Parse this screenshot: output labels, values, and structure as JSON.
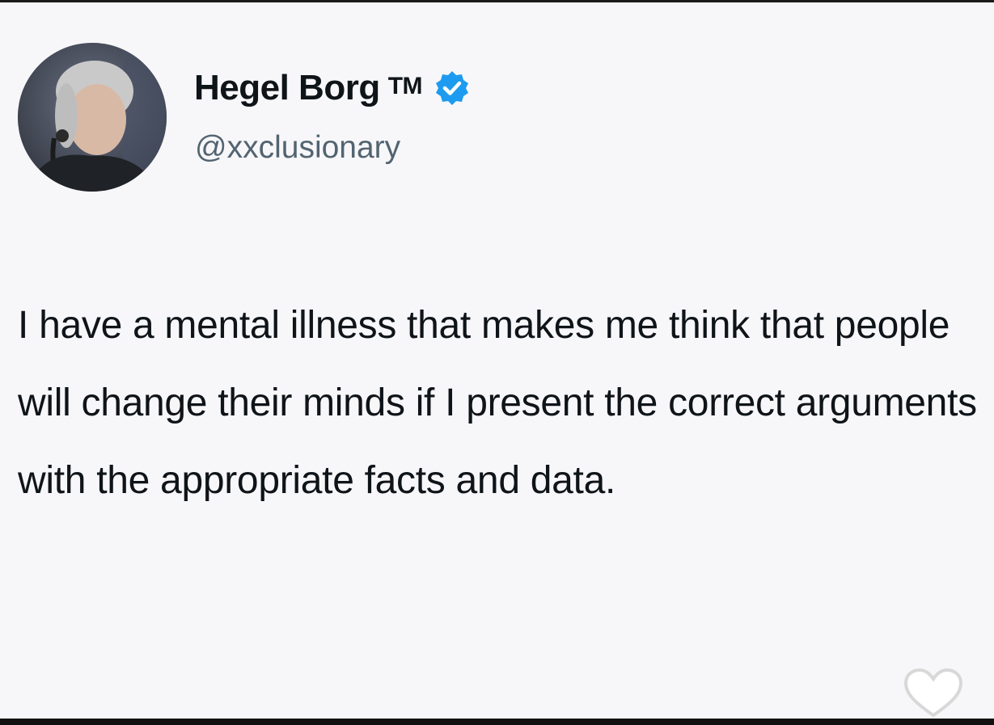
{
  "tweet": {
    "author": {
      "display_name": "Hegel Borg",
      "suffix": "TM",
      "handle": "@xxclusionary",
      "verified": true,
      "verified_color": "#1d9bf0"
    },
    "text": "I have a mental illness that makes me think that people will change their minds if I present the correct arguments with the appropriate facts and data."
  },
  "icons": {
    "verified": "verified-badge-icon",
    "like": "heart-icon"
  }
}
